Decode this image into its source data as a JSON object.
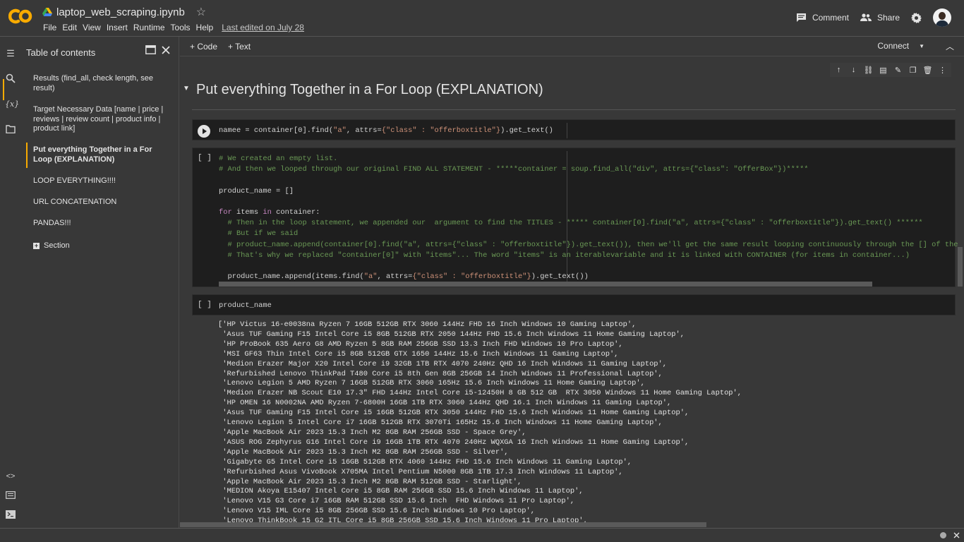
{
  "header": {
    "notebook_title": "laptop_web_scraping.ipynb",
    "menu": [
      "File",
      "Edit",
      "View",
      "Insert",
      "Runtime",
      "Tools",
      "Help"
    ],
    "last_edited": "Last edited on July 28",
    "comment_label": "Comment",
    "share_label": "Share",
    "accent_color": "#f9ab00"
  },
  "sidebar": {
    "title": "Table of contents",
    "items": [
      {
        "label": "Results (find_all, check length, see result)"
      },
      {
        "label": "Target Necessary Data [name | price | reviews | review count | product info | product link]"
      },
      {
        "label": "Put everything Together in a For Loop (EXPLANATION)"
      },
      {
        "label": "LOOP EVERYTHING!!!!"
      },
      {
        "label": "URL CONCATENATION"
      },
      {
        "label": "PANDAS!!!"
      }
    ],
    "section_label": "Section"
  },
  "toolbar": {
    "code_label": "+ Code",
    "text_label": "+ Text",
    "connect_label": "Connect"
  },
  "heading": "Put everything Together in a For Loop (EXPLANATION)",
  "cells": {
    "cell1": {
      "code_prefix": "namee = container[0].find(",
      "code_str1": "\"a\"",
      "code_mid": ", attrs=",
      "code_str2": "{\"class\" : \"offerboxtitle\"}",
      "code_suffix": ").get_text()"
    },
    "cell2": {
      "exec": "[ ]",
      "comment1": "# We created an empty list.",
      "comment2": "# And then we looped through our original FIND ALL STATEMENT - *****container = soup.find_all(\"div\", attrs={\"class\": \"OfferBox\"})*****",
      "assign": "product_name = []",
      "for_kw": "for",
      "for_var": " items ",
      "in_kw": "in",
      "for_rest": " container:",
      "comment3": "  # Then in the loop statement, we appended our  argument to find the TITLES - ***** container[0].find(\"a\", attrs={\"class\" : \"offerboxtitle\"}).get_text() ******",
      "comment4": "  # But if we said",
      "comment5": "  # product_name.append(container[0].find(\"a\", attrs={\"class\" : \"offerboxtitle\"}).get_text()), then we'll get the same result looping continuously through the [] of the",
      "comment6": "  # That's why we replaced \"container[0]\" with \"items\"... The word \"items\" is an iterablevariable and it is linked with CONTAINER (for items in container...)",
      "append_prefix": "  product_name.append(items.find(",
      "append_str1": "\"a\"",
      "append_mid": ", attrs=",
      "append_str2": "{\"class\" : \"offerboxtitle\"}",
      "append_suffix": ").get_text())"
    },
    "cell3": {
      "exec": "[ ]",
      "code": "product_name"
    }
  },
  "output_lines": [
    "['HP Victus 16-e0038na Ryzen 7 16GB 512GB RTX 3060 144Hz FHD 16 Inch Windows 10 Gaming Laptop',",
    " 'Asus TUF Gaming F15 Intel Core i5 8GB 512GB RTX 2050 144Hz FHD 15.6 Inch Windows 11 Home Gaming Laptop',",
    " 'HP ProBook 635 Aero G8 AMD Ryzen 5 8GB RAM 256GB SSD 13.3 Inch FHD Windows 10 Pro Laptop',",
    " 'MSI GF63 Thin Intel Core i5 8GB 512GB GTX 1650 144Hz 15.6 Inch Windows 11 Gaming Laptop',",
    " 'Medion Erazer Major X20 Intel Core i9 32GB 1TB RTX 4070 240Hz QHD 16 Inch Windows 11 Gaming Laptop',",
    " 'Refurbished Lenovo ThinkPad T480 Core i5 8th Gen 8GB 256GB 14 Inch Windows 11 Professional Laptop',",
    " 'Lenovo Legion 5 AMD Ryzen 7 16GB 512GB RTX 3060 165Hz 15.6 Inch Windows 11 Home Gaming Laptop',",
    " 'Medion Erazer NB Scout E10 17.3\" FHD 144Hz Intel Core i5-12450H 8 GB 512 GB  RTX 3050 Windows 11 Home Gaming Laptop',",
    " 'HP OMEN 16 N0002NA AMD Ryzen 7-6800H 16GB 1TB RTX 3060 144Hz QHD 16.1 Inch Windows 11 Gaming Laptop',",
    " 'Asus TUF Gaming F15 Intel Core i5 16GB 512GB RTX 3050 144Hz FHD 15.6 Inch Windows 11 Home Gaming Laptop',",
    " 'Lenovo Legion 5 Intel Core i7 16GB 512GB RTX 3070Ti 165Hz 15.6 Inch Windows 11 Home Gaming Laptop',",
    " 'Apple MacBook Air 2023 15.3 Inch M2 8GB RAM 256GB SSD - Space Grey',",
    " 'ASUS ROG Zephyrus G16 Intel Core i9 16GB 1TB RTX 4070 240Hz WQXGA 16 Inch Windows 11 Home Gaming Laptop',",
    " 'Apple MacBook Air 2023 15.3 Inch M2 8GB RAM 256GB SSD - Silver',",
    " 'Gigabyte G5 Intel Core i5 16GB 512GB RTX 4060 144Hz FHD 15.6 Inch Windows 11 Gaming Laptop',",
    " 'Refurbished Asus VivoBook X705MA Intel Pentium N5000 8GB 1TB 17.3 Inch Windows 11 Laptop',",
    " 'Apple MacBook Air 2023 15.3 Inch M2 8GB RAM 512GB SSD - Starlight',",
    " 'MEDION Akoya E15407 Intel Core i5 8GB RAM 256GB SSD 15.6 Inch Windows 11 Laptop',",
    " 'Lenovo V15 G3 Core i7 16GB RAM 512GB SSD 15.6 Inch  FHD Windows 11 Pro Laptop',",
    " 'Lenovo V15 IML Core i5 8GB 256GB SSD 15.6 Inch Windows 10 Pro Laptop',",
    " 'Lenovo ThinkBook 15 G2 ITL Core i5 8GB 256GB SSD 15.6 Inch Windows 11 Pro Laptop',"
  ]
}
